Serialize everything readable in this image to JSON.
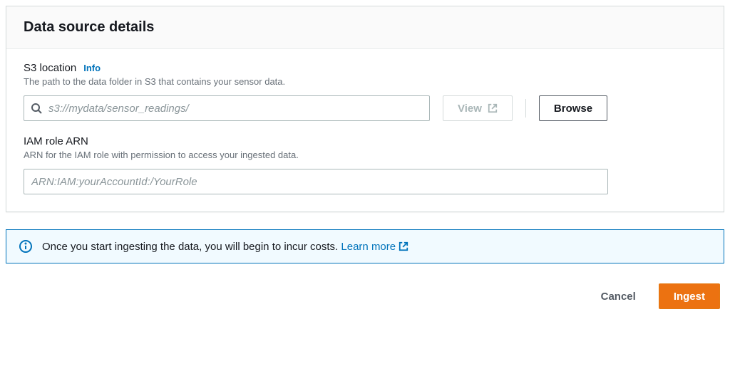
{
  "panel": {
    "title": "Data source details"
  },
  "s3": {
    "label": "S3 location",
    "info": "Info",
    "desc": "The path to the data folder in S3 that contains your sensor data.",
    "placeholder": "s3://mydata/sensor_readings/",
    "view": "View",
    "browse": "Browse"
  },
  "iam": {
    "label": "IAM role ARN",
    "desc": "ARN for the IAM role with permission to access your ingested data.",
    "placeholder": "ARN:IAM:yourAccountId:/YourRole"
  },
  "alert": {
    "text": "Once you start ingesting the data, you will begin to incur costs.",
    "learn_more": "Learn more"
  },
  "footer": {
    "cancel": "Cancel",
    "ingest": "Ingest"
  }
}
